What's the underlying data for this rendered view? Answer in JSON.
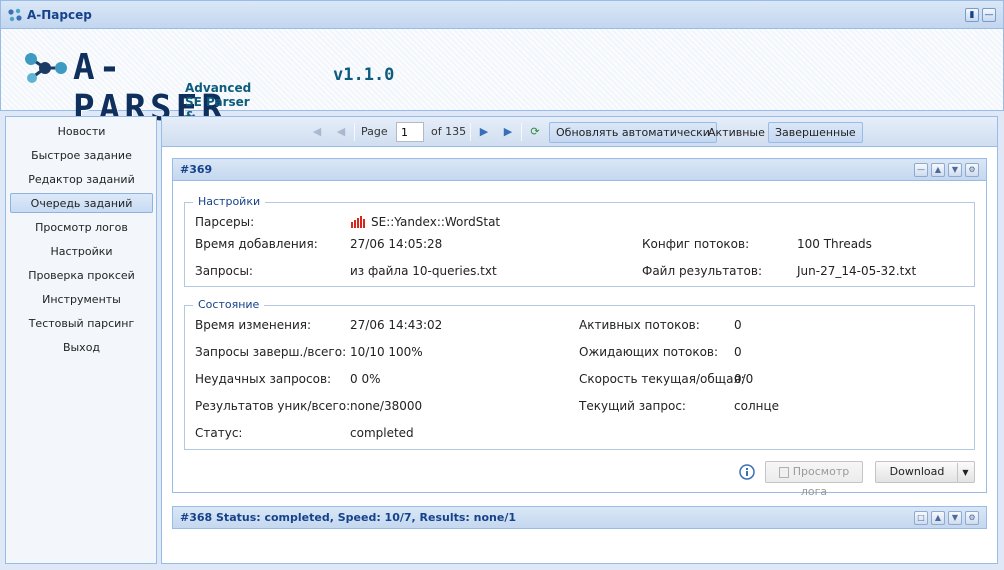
{
  "window": {
    "title": "A-Парсер"
  },
  "header": {
    "logo_text": "A-PARSER",
    "version": "v1.1.0",
    "tagline": "Advanced SE Parser & Analyze tool"
  },
  "sidebar": {
    "items": [
      {
        "label": "Новости"
      },
      {
        "label": "Быстрое задание"
      },
      {
        "label": "Редактор заданий"
      },
      {
        "label": "Очередь заданий",
        "selected": true
      },
      {
        "label": "Просмотр логов"
      },
      {
        "label": "Настройки"
      },
      {
        "label": "Проверка проксей"
      },
      {
        "label": "Инструменты"
      },
      {
        "label": "Тестовый парсинг"
      },
      {
        "label": "Выход"
      }
    ]
  },
  "toolbar": {
    "page_label": "Page",
    "page_value": "1",
    "of_label": "of 135",
    "auto_refresh_label": "Обновлять автоматически",
    "active_label": "Активные",
    "finished_label": "Завершенные"
  },
  "task": {
    "title": "#369",
    "settings": {
      "legend": "Настройки",
      "parsers_label": "Парсеры:",
      "parsers_value": "SE::Yandex::WordStat",
      "added_label": "Время добавления:",
      "added_value": "27/06 14:05:28",
      "queries_label": "Запросы:",
      "queries_value": "из файла 10-queries.txt",
      "threads_label": "Конфиг потоков:",
      "threads_value": "100 Threads",
      "result_file_label": "Файл результатов:",
      "result_file_value": "Jun-27_14-05-32.txt"
    },
    "state": {
      "legend": "Состояние",
      "changed_label": "Время изменения:",
      "changed_value": "27/06 14:43:02",
      "done_label": "Запросы заверш./всего:",
      "done_value": "10/10 100%",
      "failed_label": "Неудачных запросов:",
      "failed_value": "0 0%",
      "results_label": "Результатов уник/всего:",
      "results_value": "none/38000",
      "status_label": "Статус:",
      "status_value": "completed",
      "active_threads_label": "Активных потоков:",
      "active_threads_value": "0",
      "waiting_threads_label": "Ожидающих потоков:",
      "waiting_threads_value": "0",
      "speed_label": "Скорость текущая/общая:",
      "speed_value": "0/0",
      "current_query_label": "Текущий запрос:",
      "current_query_value": "солнце"
    },
    "view_log_label": "Просмотр лога",
    "download_label": "Download"
  },
  "task2": {
    "title": "#368 Status: completed, Speed: 10/7, Results: none/1"
  },
  "colors": {
    "header_text": "#15428b",
    "border": "#99bbe8",
    "parser_icon": "#d9261c"
  }
}
